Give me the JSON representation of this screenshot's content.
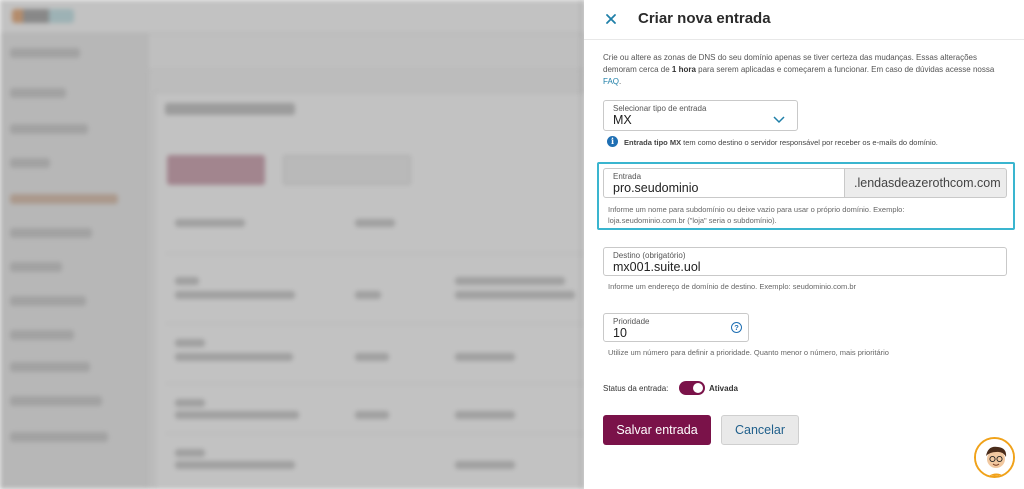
{
  "drawer": {
    "title": "Criar nova entrada",
    "intro": {
      "part1": "Crie ou altere as zonas de DNS do seu domínio apenas se tiver certeza das mudanças. Essas alterações demoram cerca de ",
      "bold": "1 hora",
      "part2": " para serem aplicadas e começarem a funcionar. Em caso de dúvidas acesse nossa ",
      "link": "FAQ",
      "end": "."
    },
    "entry_type": {
      "label": "Selecionar tipo de entrada",
      "value": "MX"
    },
    "entry_type_info": {
      "bold": "Entrada tipo MX",
      "text": " tem como destino o servidor responsável por receber os e-mails do domínio."
    },
    "entry": {
      "label": "Entrada",
      "value": "pro.seudominio",
      "suffix": ".lendasdeazerothcom.com",
      "help_line1": "Informe um nome para subdomínio ou deixe vazio para usar o próprio domínio. Exemplo:",
      "help_line2": "loja.seudominio.com.br (\"loja\" seria o subdomínio)."
    },
    "destination": {
      "label": "Destino (obrigatório)",
      "value": "mx001.suite.uol",
      "help": "Informe um endereço de domínio de destino. Exemplo: seudominio.com.br"
    },
    "priority": {
      "label": "Prioridade",
      "value": "10",
      "help_icon": "?",
      "help": "Utilize um número para definir a prioridade. Quanto menor o número, mais prioritário"
    },
    "status": {
      "label": "Status da entrada:",
      "value": "Ativada",
      "enabled": true
    },
    "buttons": {
      "save": "Salvar entrada",
      "cancel": "Cancelar"
    }
  },
  "icons": {
    "close": "close-icon",
    "chevron": "chevron-down-icon",
    "info": "info-icon",
    "help": "help-icon",
    "avatar": "assistant-avatar"
  },
  "colors": {
    "primary": "#7a1249",
    "accent_border": "#3ab5cf",
    "info_blue": "#1f6fb3",
    "link": "#1f7fa8"
  }
}
